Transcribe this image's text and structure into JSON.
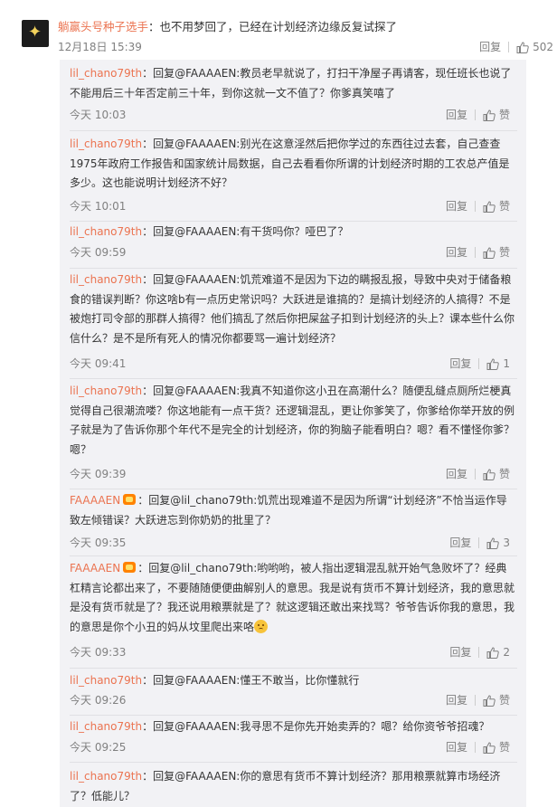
{
  "parent": {
    "username": "躺赢头号种子选手",
    "text": "：也不用梦回了，已经在计划经济边缘反复试探了",
    "time": "12月18日 15:39",
    "reply_label": "回复",
    "like_count": "502"
  },
  "replies": [
    {
      "name": "lil_chano79th",
      "text": "：回复@FAAAAEN:教员老早就说了，打扫干净屋子再请客，现任班长也说了不能用后三十年否定前三十年，到你这就一文不值了？你爹真笑嘻了",
      "time": "今天 10:03",
      "reply_label": "回复",
      "like": "赞"
    },
    {
      "name": "lil_chano79th",
      "text": "：回复@FAAAAEN:别光在这意淫然后把你学过的东西往过去套，自己查查1975年政府工作报告和国家统计局数据，自己去看看你所谓的计划经济时期的工农总产值是多少。这也能说明计划经济不好？",
      "time": "今天 10:01",
      "reply_label": "回复",
      "like": "赞"
    },
    {
      "name": "lil_chano79th",
      "text": "：回复@FAAAAEN:有干货吗你？哑巴了？",
      "time": "今天 09:59",
      "reply_label": "回复",
      "like": "赞"
    },
    {
      "name": "lil_chano79th",
      "text": "：回复@FAAAAEN:饥荒难道不是因为下边的瞒报乱报，导致中央对于储备粮食的错误判断？你这啥b有一点历史常识吗？大跃进是谁搞的？是搞计划经济的人搞得？不是被炮打司令部的那群人搞得？他们搞乱了然后你把屎盆子扣到计划经济的头上？课本些什么你信什么？是不是所有死人的情况你都要骂一遍计划经济？",
      "time": "今天 09:41",
      "reply_label": "回复",
      "like": "1"
    },
    {
      "name": "lil_chano79th",
      "text": "：回复@FAAAAEN:我真不知道你这小丑在高潮什么？随便乱缝点厕所烂梗真觉得自己很潮流喽？你这地能有一点干货？还逻辑混乱，更让你爹笑了，你爹给你举开放的例子就是为了告诉你那个年代不是完全的计划经济，你的狗脑子能看明白？嗯？看不懂怪你爹？嗯？",
      "time": "今天 09:39",
      "reply_label": "回复",
      "like": "赞"
    },
    {
      "name": "FAAAAEN",
      "text": "：回复@lil_chano79th:饥荒出现难道不是因为所谓“计划经济”不恰当运作导致左倾错误？大跃进忘到你奶奶的批里了？",
      "time": "今天 09:35",
      "reply_label": "回复",
      "like": "3"
    },
    {
      "name": "FAAAAEN",
      "text": "：回复@lil_chano79th:哟哟哟，被人指出逻辑混乱就开始气急败坏了？经典杠精言论都出来了，不要随随便便曲解别人的意思。我是说有货币不算计划经济，我的意思就是没有货币就是了？我还说用粮票就是了？就这逻辑还敢出来找骂？爷爷告诉你我的意思，我的意思是你个小丑的妈从坟里爬出来咯",
      "time": "今天 09:33",
      "reply_label": "回复",
      "like": "2"
    },
    {
      "name": "lil_chano79th",
      "text": "：回复@FAAAAEN:懂王不敢当，比你懂就行",
      "time": "今天 09:26",
      "reply_label": "回复",
      "like": "赞"
    },
    {
      "name": "lil_chano79th",
      "text": "：回复@FAAAAEN:我寻思不是你先开始卖弄的？嗯？给你资爷爷招魂？",
      "time": "今天 09:25",
      "reply_label": "回复",
      "like": "赞"
    },
    {
      "name": "lil_chano79th",
      "text": "：回复@FAAAAEN:你的意思有货币不算计划经济？那用粮票就算市场经济了？低能儿？",
      "time": "",
      "reply_label": "",
      "like": ""
    }
  ]
}
